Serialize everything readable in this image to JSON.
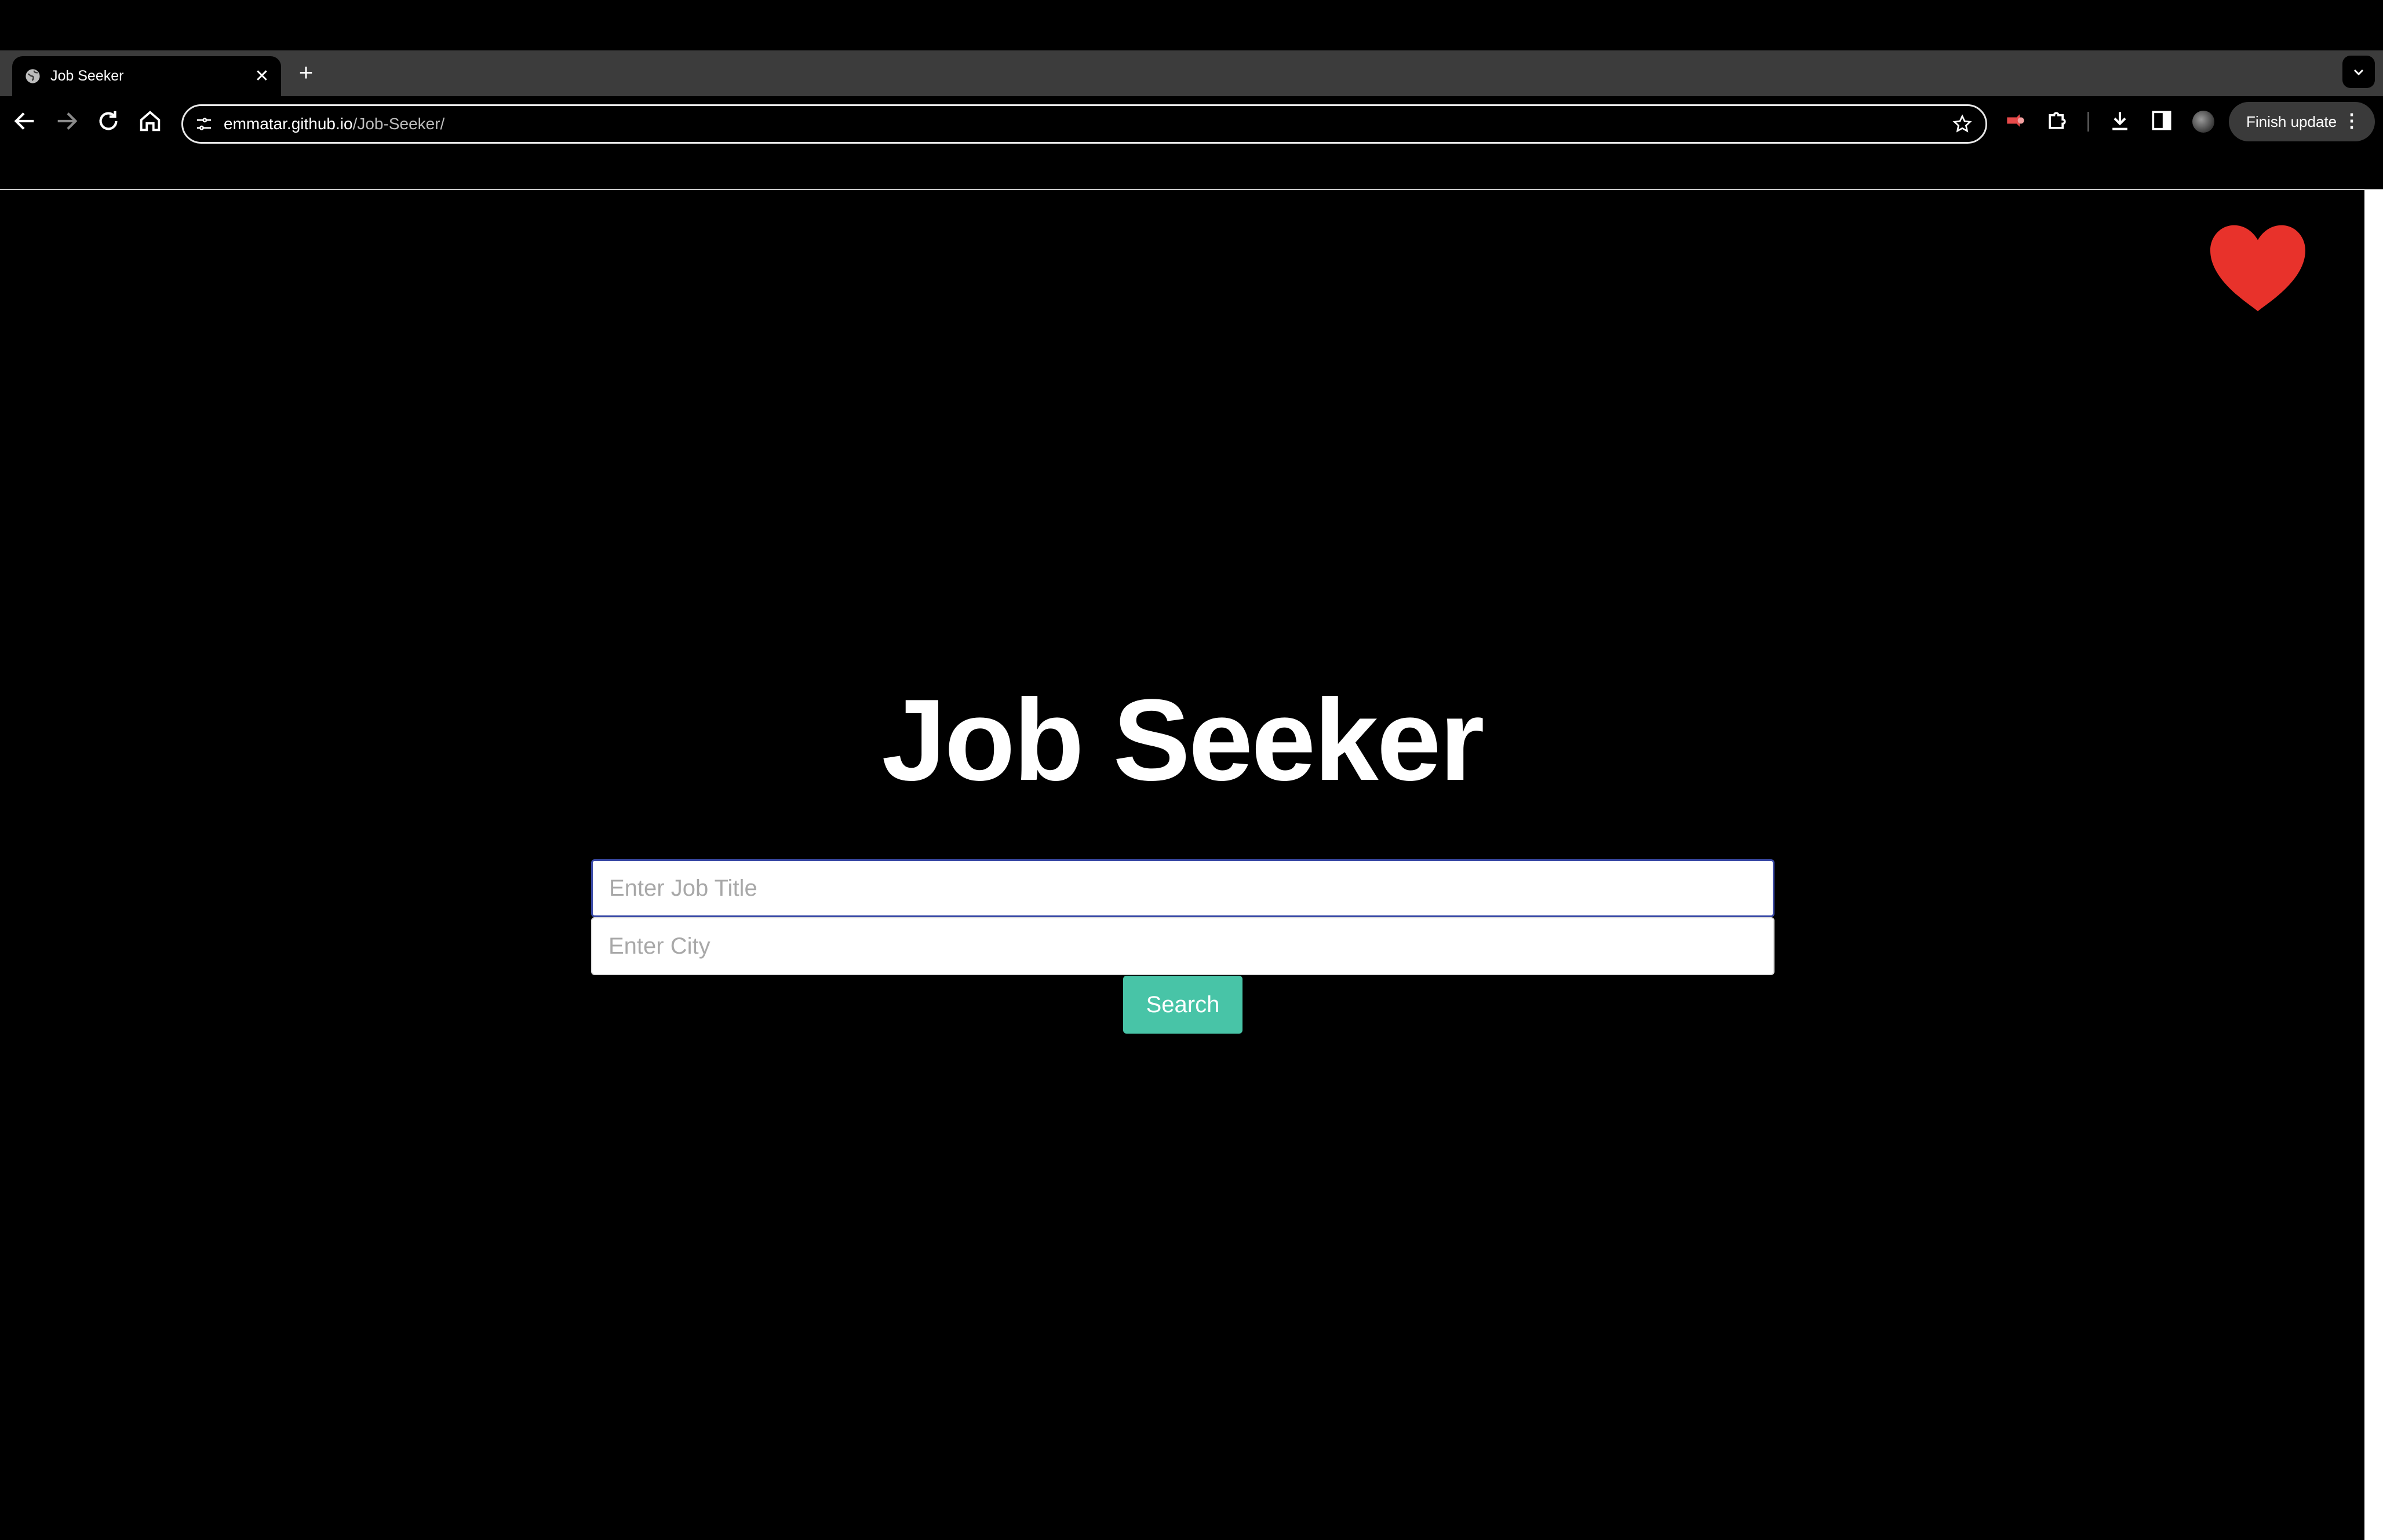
{
  "browser": {
    "tab": {
      "title": "Job Seeker",
      "icon": "globe-icon",
      "close_icon": "close-icon"
    },
    "new_tab_icon": "plus-icon",
    "tab_menu_icon": "chevron-down-icon",
    "toolbar": {
      "back_icon": "back-arrow-icon",
      "forward_icon": "forward-arrow-icon",
      "reload_icon": "reload-icon",
      "home_icon": "home-icon",
      "url_host": "emmatar.github.io",
      "url_path": "/Job-Seeker/",
      "bookmark_icon": "star-icon",
      "finish_update_label": "Finish update",
      "menu_icon": "kebab-menu-icon"
    }
  },
  "page": {
    "title": "Job Seeker",
    "favorite_icon": "heart-icon",
    "heart_color": "#e8322b",
    "job_title_input": {
      "placeholder": "Enter Job Title",
      "value": ""
    },
    "city_input": {
      "placeholder": "Enter City",
      "value": ""
    },
    "search_button_label": "Search",
    "accent_color": "#48c4a7"
  }
}
